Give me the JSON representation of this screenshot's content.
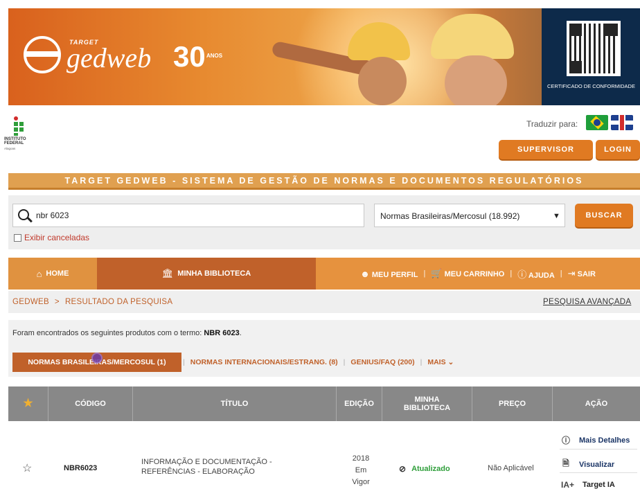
{
  "banner": {
    "brand_small": "TARGET",
    "brand": "gedweb",
    "anniversary": "30",
    "anniversary_sub": "ANOS",
    "certificate": "CERTIFICADO DE CONFORMIDADE"
  },
  "institution": {
    "name_line1": "INSTITUTO",
    "name_line2": "FEDERAL",
    "sub": "Alagoas"
  },
  "header": {
    "translate_label": "Traduzir para:",
    "supervisor": "SUPERVISOR",
    "login": "LOGIN"
  },
  "title_bar": "TARGET GEDWEB - SISTEMA DE GESTÃO DE NORMAS E DOCUMENTOS REGULATÓRIOS",
  "search": {
    "value": "nbr 6023",
    "collection": "Normas Brasileiras/Mercosul (18.992)",
    "button": "BUSCAR",
    "show_cancelled": "Exibir canceladas"
  },
  "nav": {
    "home": "HOME",
    "library": "MINHA BIBLIOTECA",
    "profile": "MEU PERFIL",
    "cart": "MEU CARRINHO",
    "help": "AJUDA",
    "exit": "SAIR",
    "separator": "|"
  },
  "breadcrumb": {
    "root": "GEDWEB",
    "arrow": ">",
    "current": "RESULTADO DA PESQUISA",
    "advanced": "PESQUISA AVANÇADA"
  },
  "results": {
    "found_prefix": "Foram encontrados os seguintes produtos com o termo:",
    "term": "NBR 6023",
    "term_suffix": ".",
    "tab_active": "NORMAS BRASILEIRAS/MERCOSUL (1)",
    "tab_intl": "NORMAS INTERNACIONAIS/ESTRANG. (8)",
    "tab_genius": "GENIUS/FAQ (200)",
    "tab_more": "MAIS",
    "separator": "|"
  },
  "table": {
    "headers": {
      "code": "CÓDIGO",
      "title": "TÍTULO",
      "edition": "EDIÇÃO",
      "library_1": "MINHA",
      "library_2": "BIBLIOTECA",
      "price": "PREÇO",
      "action": "AÇÃO"
    },
    "row": {
      "code": "NBR6023",
      "title_1": "INFORMAÇÃO E DOCUMENTAÇÃO -",
      "title_2": "REFERÊNCIAS - ELABORAÇÃO",
      "edition_1": "2018",
      "edition_2": "Em",
      "edition_3": "Vigor",
      "library_status": "Atualizado",
      "price": "Não Aplicável",
      "actions": {
        "details": "Mais Detalhes",
        "view": "Visualizar",
        "ai": "Target IA",
        "ai_icon": "IA+"
      }
    }
  },
  "colors": {
    "orange": "#e07a22",
    "dark_orange": "#c0612a",
    "green": "#2e9e3a",
    "navy": "#1b3566"
  }
}
